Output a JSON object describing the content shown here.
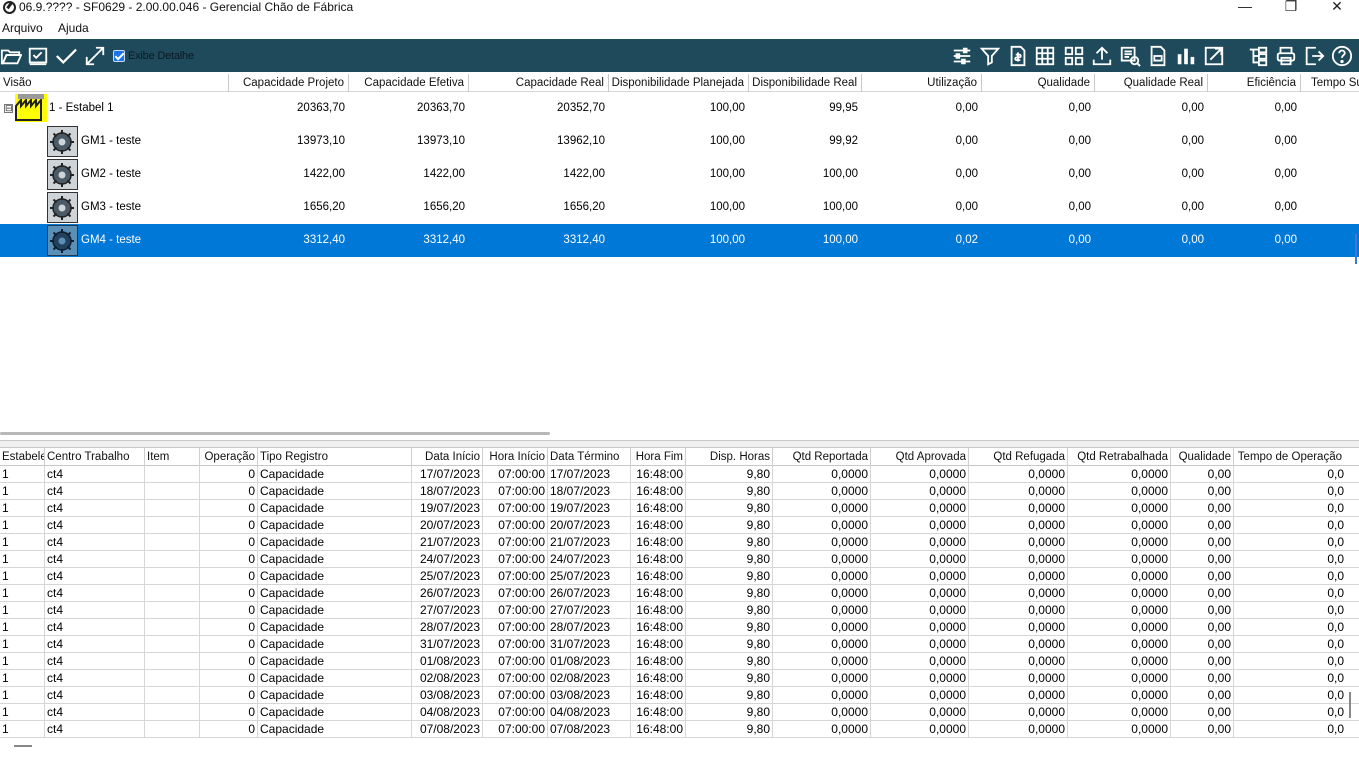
{
  "window": {
    "title": "06.9.???? - SF0629 - 2.00.00.046 - Gerencial Chão de Fábrica",
    "minimize": "—",
    "maximize": "❐",
    "close": "✕"
  },
  "menu": [
    "Arquivo",
    "Ajuda"
  ],
  "toolbar": {
    "exibe_detalhe_label": "Exibe Detalhe",
    "exibe_detalhe_checked": true,
    "left_icons": [
      "folder-open-icon",
      "inbox-check-icon",
      "checkmark-icon",
      "expand-icon"
    ],
    "right_icons": [
      "sliders-icon",
      "filter-icon",
      "document-money-icon",
      "calculator-icon",
      "grid-icon",
      "upload-icon",
      "print-preview-icon",
      "money-report-icon",
      "bar-chart-icon",
      "external-link-icon",
      "hierarchy-icon",
      "printer-icon",
      "exit-icon",
      "help-icon"
    ]
  },
  "colors": {
    "toolbar_bg": "#1e4a5b",
    "selection": "#0078d7",
    "estab_icon": "#ffff00"
  },
  "upper_grid": {
    "columns": [
      "Visão",
      "Capacidade Projeto",
      "Capacidade Efetiva",
      "Capacidade Real",
      "Disponibilidade Planejada",
      "Disponibilidade Real",
      "Utilização",
      "Qualidade",
      "Qualidade Real",
      "Eficiência",
      "Tempo Su"
    ],
    "rows": [
      {
        "label": "1 - Estabel 1",
        "values": [
          "20363,70",
          "20363,70",
          "20352,70",
          "100,00",
          "99,95",
          "0,00",
          "0,00",
          "0,00",
          "0,00"
        ]
      },
      {
        "label": "GM1 - teste",
        "values": [
          "13973,10",
          "13973,10",
          "13962,10",
          "100,00",
          "99,92",
          "0,00",
          "0,00",
          "0,00",
          "0,00"
        ]
      },
      {
        "label": "GM2 - teste",
        "values": [
          "1422,00",
          "1422,00",
          "1422,00",
          "100,00",
          "100,00",
          "0,00",
          "0,00",
          "0,00",
          "0,00"
        ]
      },
      {
        "label": "GM3 - teste",
        "values": [
          "1656,20",
          "1656,20",
          "1656,20",
          "100,00",
          "100,00",
          "0,00",
          "0,00",
          "0,00",
          "0,00"
        ]
      },
      {
        "label": "GM4 - teste",
        "values": [
          "3312,40",
          "3312,40",
          "3312,40",
          "100,00",
          "100,00",
          "0,02",
          "0,00",
          "0,00",
          "0,00"
        ]
      }
    ],
    "tree_toggle": "⊟"
  },
  "lower_grid": {
    "columns": [
      "Estabelec",
      "Centro Trabalho",
      "Item",
      "Operação",
      "Tipo Registro",
      "Data Início",
      "Hora Início",
      "Data Término",
      "Hora Fim",
      "Disp. Horas",
      "Qtd Reportada",
      "Qtd Aprovada",
      "Qtd Refugada",
      "Qtd Retrabalhada",
      "Qualidade",
      "Tempo de Operação"
    ],
    "rows": [
      [
        "1",
        "ct4",
        "",
        "0",
        "Capacidade",
        "17/07/2023",
        "07:00:00",
        "17/07/2023",
        "16:48:00",
        "9,80",
        "0,0000",
        "0,0000",
        "0,0000",
        "0,0000",
        "0,00",
        "0,0"
      ],
      [
        "1",
        "ct4",
        "",
        "0",
        "Capacidade",
        "18/07/2023",
        "07:00:00",
        "18/07/2023",
        "16:48:00",
        "9,80",
        "0,0000",
        "0,0000",
        "0,0000",
        "0,0000",
        "0,00",
        "0,0"
      ],
      [
        "1",
        "ct4",
        "",
        "0",
        "Capacidade",
        "19/07/2023",
        "07:00:00",
        "19/07/2023",
        "16:48:00",
        "9,80",
        "0,0000",
        "0,0000",
        "0,0000",
        "0,0000",
        "0,00",
        "0,0"
      ],
      [
        "1",
        "ct4",
        "",
        "0",
        "Capacidade",
        "20/07/2023",
        "07:00:00",
        "20/07/2023",
        "16:48:00",
        "9,80",
        "0,0000",
        "0,0000",
        "0,0000",
        "0,0000",
        "0,00",
        "0,0"
      ],
      [
        "1",
        "ct4",
        "",
        "0",
        "Capacidade",
        "21/07/2023",
        "07:00:00",
        "21/07/2023",
        "16:48:00",
        "9,80",
        "0,0000",
        "0,0000",
        "0,0000",
        "0,0000",
        "0,00",
        "0,0"
      ],
      [
        "1",
        "ct4",
        "",
        "0",
        "Capacidade",
        "24/07/2023",
        "07:00:00",
        "24/07/2023",
        "16:48:00",
        "9,80",
        "0,0000",
        "0,0000",
        "0,0000",
        "0,0000",
        "0,00",
        "0,0"
      ],
      [
        "1",
        "ct4",
        "",
        "0",
        "Capacidade",
        "25/07/2023",
        "07:00:00",
        "25/07/2023",
        "16:48:00",
        "9,80",
        "0,0000",
        "0,0000",
        "0,0000",
        "0,0000",
        "0,00",
        "0,0"
      ],
      [
        "1",
        "ct4",
        "",
        "0",
        "Capacidade",
        "26/07/2023",
        "07:00:00",
        "26/07/2023",
        "16:48:00",
        "9,80",
        "0,0000",
        "0,0000",
        "0,0000",
        "0,0000",
        "0,00",
        "0,0"
      ],
      [
        "1",
        "ct4",
        "",
        "0",
        "Capacidade",
        "27/07/2023",
        "07:00:00",
        "27/07/2023",
        "16:48:00",
        "9,80",
        "0,0000",
        "0,0000",
        "0,0000",
        "0,0000",
        "0,00",
        "0,0"
      ],
      [
        "1",
        "ct4",
        "",
        "0",
        "Capacidade",
        "28/07/2023",
        "07:00:00",
        "28/07/2023",
        "16:48:00",
        "9,80",
        "0,0000",
        "0,0000",
        "0,0000",
        "0,0000",
        "0,00",
        "0,0"
      ],
      [
        "1",
        "ct4",
        "",
        "0",
        "Capacidade",
        "31/07/2023",
        "07:00:00",
        "31/07/2023",
        "16:48:00",
        "9,80",
        "0,0000",
        "0,0000",
        "0,0000",
        "0,0000",
        "0,00",
        "0,0"
      ],
      [
        "1",
        "ct4",
        "",
        "0",
        "Capacidade",
        "01/08/2023",
        "07:00:00",
        "01/08/2023",
        "16:48:00",
        "9,80",
        "0,0000",
        "0,0000",
        "0,0000",
        "0,0000",
        "0,00",
        "0,0"
      ],
      [
        "1",
        "ct4",
        "",
        "0",
        "Capacidade",
        "02/08/2023",
        "07:00:00",
        "02/08/2023",
        "16:48:00",
        "9,80",
        "0,0000",
        "0,0000",
        "0,0000",
        "0,0000",
        "0,00",
        "0,0"
      ],
      [
        "1",
        "ct4",
        "",
        "0",
        "Capacidade",
        "03/08/2023",
        "07:00:00",
        "03/08/2023",
        "16:48:00",
        "9,80",
        "0,0000",
        "0,0000",
        "0,0000",
        "0,0000",
        "0,00",
        "0,0"
      ],
      [
        "1",
        "ct4",
        "",
        "0",
        "Capacidade",
        "04/08/2023",
        "07:00:00",
        "04/08/2023",
        "16:48:00",
        "9,80",
        "0,0000",
        "0,0000",
        "0,0000",
        "0,0000",
        "0,00",
        "0,0"
      ],
      [
        "1",
        "ct4",
        "",
        "0",
        "Capacidade",
        "07/08/2023",
        "07:00:00",
        "07/08/2023",
        "16:48:00",
        "9,80",
        "0,0000",
        "0,0000",
        "0,0000",
        "0,0000",
        "0,00",
        "0,0"
      ]
    ]
  }
}
